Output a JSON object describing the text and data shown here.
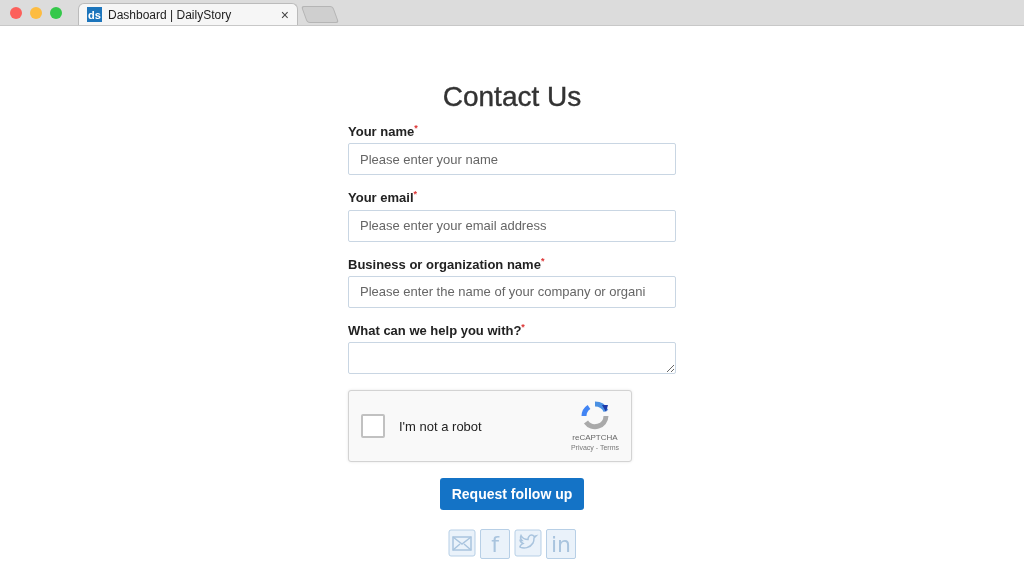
{
  "browser": {
    "tab": {
      "favicon": "ds",
      "title": "Dashboard | DailyStory",
      "close": "×",
      "selected": true
    }
  },
  "form": {
    "title": "Contact Us",
    "fields": [
      {
        "kind": "input",
        "label": "Your name",
        "required_mark": "*",
        "placeholder": "Please enter your name"
      },
      {
        "kind": "input",
        "label": "Your email",
        "required_mark": "*",
        "placeholder": "Please enter your email address"
      },
      {
        "kind": "input",
        "label": "Business or organization name",
        "required_mark": "*",
        "placeholder": "Please enter the name of your company or organi"
      },
      {
        "kind": "textarea",
        "label": "What can we help you with?",
        "required_mark": "*"
      }
    ],
    "captcha": {
      "label": "I'm not a robot",
      "checked": false,
      "brand": "reCAPTCHA",
      "links": "Privacy - Terms"
    },
    "submit": "Request follow up",
    "social": [
      {
        "kind": "mail"
      },
      {
        "kind": "letter",
        "glyph": "f"
      },
      {
        "kind": "bird"
      },
      {
        "kind": "letter",
        "glyph": "in"
      }
    ]
  }
}
